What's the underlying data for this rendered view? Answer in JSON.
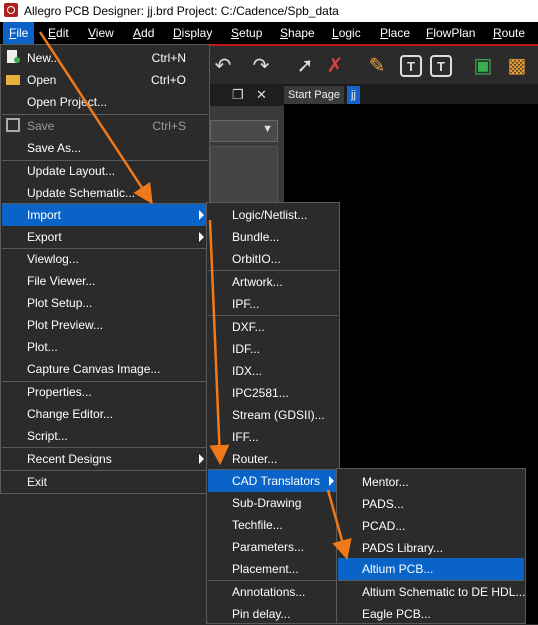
{
  "window": {
    "title": "Allegro PCB Designer: jj.brd  Project: C:/Cadence/Spb_data"
  },
  "menubar": {
    "items": [
      {
        "label": "File",
        "key": "F",
        "rest": "ile"
      },
      {
        "label": "Edit",
        "key": "E",
        "rest": "dit"
      },
      {
        "label": "View",
        "key": "V",
        "rest": "iew"
      },
      {
        "label": "Add",
        "key": "A",
        "rest": "dd"
      },
      {
        "label": "Display",
        "key": "D",
        "rest": "isplay"
      },
      {
        "label": "Setup",
        "key": "S",
        "rest": "etup"
      },
      {
        "label": "Shape",
        "key": "S",
        "rest": "hape"
      },
      {
        "label": "Logic",
        "key": "L",
        "rest": "ogic"
      },
      {
        "label": "Place",
        "key": "P",
        "rest": "lace"
      },
      {
        "label": "FlowPlan",
        "key": "F",
        "rest": "lowPlan"
      },
      {
        "label": "Route",
        "key": "R",
        "rest": "oute"
      }
    ]
  },
  "file_menu": {
    "items": [
      {
        "label": "New...",
        "shortcut": "Ctrl+N"
      },
      {
        "label": "Open",
        "shortcut": "Ctrl+O"
      },
      {
        "label": "Open Project...",
        "shortcut": ""
      },
      {
        "label": "Save",
        "shortcut": "Ctrl+S"
      },
      {
        "label": "Save As...",
        "shortcut": ""
      },
      {
        "label": "Update Layout...",
        "shortcut": ""
      },
      {
        "label": "Update Schematic...",
        "shortcut": ""
      },
      {
        "label": "Import",
        "shortcut": ""
      },
      {
        "label": "Export",
        "shortcut": ""
      },
      {
        "label": "Viewlog...",
        "shortcut": ""
      },
      {
        "label": "File Viewer...",
        "shortcut": ""
      },
      {
        "label": "Plot Setup...",
        "shortcut": ""
      },
      {
        "label": "Plot Preview...",
        "shortcut": ""
      },
      {
        "label": "Plot...",
        "shortcut": ""
      },
      {
        "label": "Capture Canvas Image...",
        "shortcut": ""
      },
      {
        "label": "Properties...",
        "shortcut": ""
      },
      {
        "label": "Change Editor...",
        "shortcut": ""
      },
      {
        "label": "Script...",
        "shortcut": ""
      },
      {
        "label": "Recent Designs",
        "shortcut": ""
      },
      {
        "label": "Exit",
        "shortcut": ""
      }
    ]
  },
  "import_menu": {
    "items": [
      {
        "label": "Logic/Netlist..."
      },
      {
        "label": "Bundle..."
      },
      {
        "label": "OrbitIO..."
      },
      {
        "label": "Artwork..."
      },
      {
        "label": "IPF..."
      },
      {
        "label": "DXF..."
      },
      {
        "label": "IDF..."
      },
      {
        "label": "IDX..."
      },
      {
        "label": "IPC2581..."
      },
      {
        "label": "Stream (GDSII)..."
      },
      {
        "label": "IFF..."
      },
      {
        "label": "Router..."
      },
      {
        "label": "CAD Translators"
      },
      {
        "label": "Sub-Drawing"
      },
      {
        "label": "Techfile..."
      },
      {
        "label": "Parameters..."
      },
      {
        "label": "Placement..."
      },
      {
        "label": "Annotations..."
      },
      {
        "label": "Pin delay..."
      }
    ]
  },
  "cad_menu": {
    "items": [
      {
        "label": "Mentor..."
      },
      {
        "label": "PADS..."
      },
      {
        "label": "PCAD..."
      },
      {
        "label": "PADS Library..."
      },
      {
        "label": "Altium PCB..."
      },
      {
        "label": "Altium Schematic to DE HDL..."
      },
      {
        "label": "Eagle PCB..."
      }
    ]
  },
  "tabs": {
    "start": "Start Page",
    "current": "jj"
  },
  "panel": {
    "restore": "❐",
    "close": "✕"
  },
  "colors": {
    "highlight": "#0a64c8",
    "annotation_arrow": "#f07a1a",
    "menubar_border": "#c01818"
  }
}
